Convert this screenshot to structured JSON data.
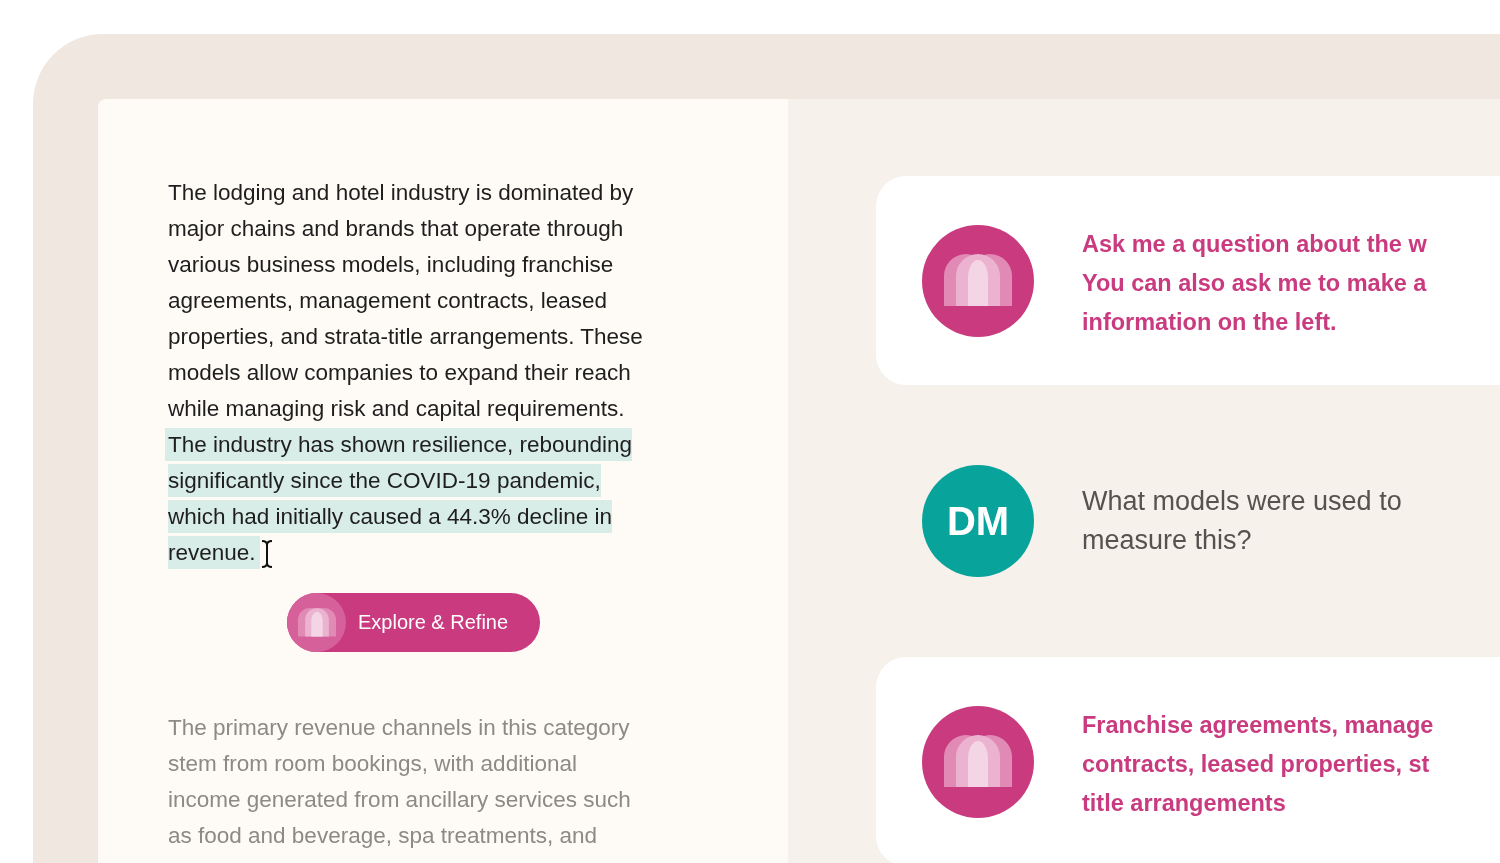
{
  "document": {
    "paragraphs": [
      {
        "text": "The lodging and hotel industry is dominated by\nmajor chains and brands that operate through\nvarious business models, including franchise\nagreements, management contracts, leased\nproperties, and strata-title arrangements. These\nmodels allow companies to expand their reach\nwhile managing risk and capital requirements.\n",
        "highlighted": "The industry has shown resilience, rebounding\nsignificantly since the COVID-19 pandemic,\nwhich had initially caused a 44.3% decline in\nrevenue.",
        "faded": false
      },
      {
        "text": "The primary revenue channels in this category\nstem from room bookings, with additional\nincome generated from ancillary services such\nas food and beverage, spa treatments, and",
        "faded": true
      }
    ],
    "button": {
      "label": "Explore & Refine"
    }
  },
  "chat": {
    "messages": [
      {
        "kind": "assistant",
        "text": "Ask me a question about the w\nYou can also ask me to make a\ninformation on the left."
      },
      {
        "kind": "user",
        "initials": "DM",
        "text": "What models were used to\nmeasure this?"
      },
      {
        "kind": "assistant",
        "text": "Franchise agreements, manage\ncontracts, leased properties, st\ntitle arrangements"
      }
    ]
  }
}
